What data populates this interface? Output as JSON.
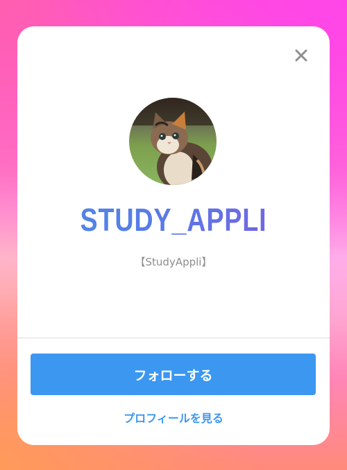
{
  "profile": {
    "username": "STUDY_APPLI",
    "display_name": "【StudyAppli】",
    "avatar_icon": "kitten-photo"
  },
  "actions": {
    "follow_label": "フォローする",
    "view_profile_label": "プロフィールを見る",
    "close_icon": "close-icon"
  },
  "colors": {
    "accent": "#3b97f0",
    "username_gradient_start": "#4f89e6",
    "username_gradient_end": "#7a5fe0",
    "secondary_text": "#8e8e8e"
  }
}
